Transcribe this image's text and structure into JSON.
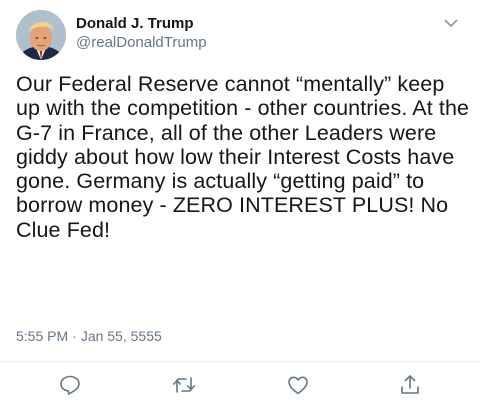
{
  "user": {
    "display_name": "Donald J. Trump",
    "handle": "@realDonaldTrump"
  },
  "tweet": {
    "text": "Our Federal Reserve cannot “mentally” keep up with the competition - other countries. At the G-7 in France, all of the other Leaders were giddy about how low their Interest Costs have gone. Germany is actually “getting paid” to borrow money - ZERO INTEREST PLUS! No Clue Fed!",
    "time": "5:55 PM",
    "separator": "·",
    "date": "Jan 55, 5555"
  },
  "icons": {
    "caret": "chevron-down-icon",
    "reply": "reply-icon",
    "retweet": "retweet-icon",
    "like": "heart-icon",
    "share": "share-icon"
  },
  "colors": {
    "text": "#14171a",
    "secondary": "#657786",
    "divider": "#e6ecf0",
    "icon": "#657786"
  }
}
